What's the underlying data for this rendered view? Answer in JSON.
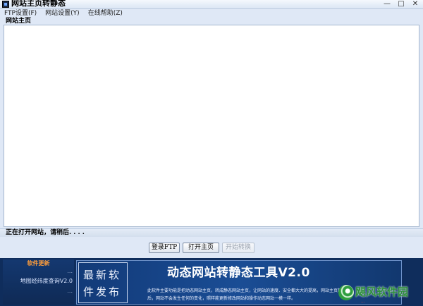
{
  "window": {
    "title": "网站主页转静态",
    "controls": {
      "minimize": "—",
      "maximize": "□",
      "close": "✕"
    }
  },
  "menu": [
    {
      "label": "FTP设置(F)"
    },
    {
      "label": "网站设置(Y)"
    },
    {
      "label": "在线帮助(Z)"
    }
  ],
  "tab": {
    "label": "网站主页"
  },
  "status": {
    "text": "正在打开网站，请稍后. . . ."
  },
  "buttons": {
    "login_ftp": "登录FTP",
    "open_home": "打开主页",
    "start_convert": "开始转换"
  },
  "banner": {
    "side_title": "软件更新",
    "side_items": [
      "...",
      "地图经纬度查询V2.0",
      "..."
    ],
    "calligraphy": [
      "最新软",
      "件发布"
    ],
    "heading": "动态网站转静态工具V2.0",
    "description": "此软件主要功能是把动态网站主页，转成静态网站主页，让网站的速度、安全都大大的提高，网站主页转换后，网站不会发生任何的变化，照样能更新修改网站和操作动态网站一模一样。"
  },
  "watermark": {
    "text": "飓风软件园",
    "url": "..."
  },
  "colors": {
    "window_bg": "#dfe8f6",
    "banner_bg": "#0f2d5c",
    "ad_accent": "#1a4d95",
    "side_title": "#ff9d3b",
    "watermark_green": "#2d8f3c"
  }
}
